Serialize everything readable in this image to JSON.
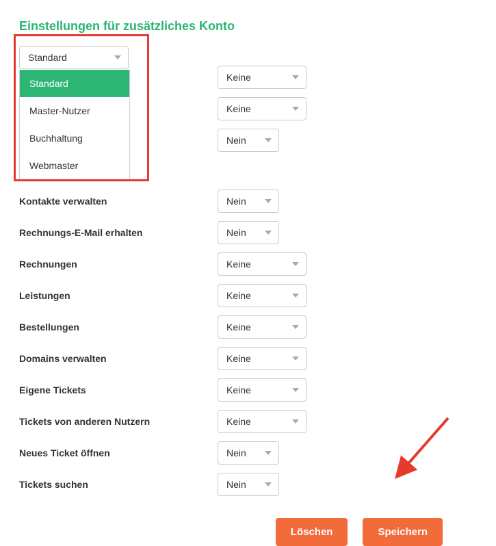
{
  "title": "Einstellungen für zusätzliches Konto",
  "roleSelect": {
    "value": "Standard",
    "options": [
      "Standard",
      "Master-Nutzer",
      "Buchhaltung",
      "Webmaster"
    ]
  },
  "rows": [
    {
      "label": "Kontakte verwalten",
      "value": "Nein",
      "size": "small"
    },
    {
      "label": "Rechnungs-E-Mail erhalten",
      "value": "Nein",
      "size": "small"
    },
    {
      "label": "Rechnungen",
      "value": "Keine",
      "size": "med"
    },
    {
      "label": "Leistungen",
      "value": "Keine",
      "size": "med"
    },
    {
      "label": "Bestellungen",
      "value": "Keine",
      "size": "med"
    },
    {
      "label": "Domains verwalten",
      "value": "Keine",
      "size": "med"
    },
    {
      "label": "Eigene Tickets",
      "value": "Keine",
      "size": "med"
    },
    {
      "label": "Tickets von anderen Nutzern",
      "value": "Keine",
      "size": "med"
    },
    {
      "label": "Neues Ticket öffnen",
      "value": "Nein",
      "size": "small"
    },
    {
      "label": "Tickets suchen",
      "value": "Nein",
      "size": "small"
    }
  ],
  "hiddenTopRows": [
    {
      "value": "Keine",
      "size": "med"
    },
    {
      "value": "Keine",
      "size": "med"
    },
    {
      "value": "Nein",
      "size": "small"
    }
  ],
  "buttons": {
    "delete": "Löschen",
    "save": "Speichern"
  }
}
